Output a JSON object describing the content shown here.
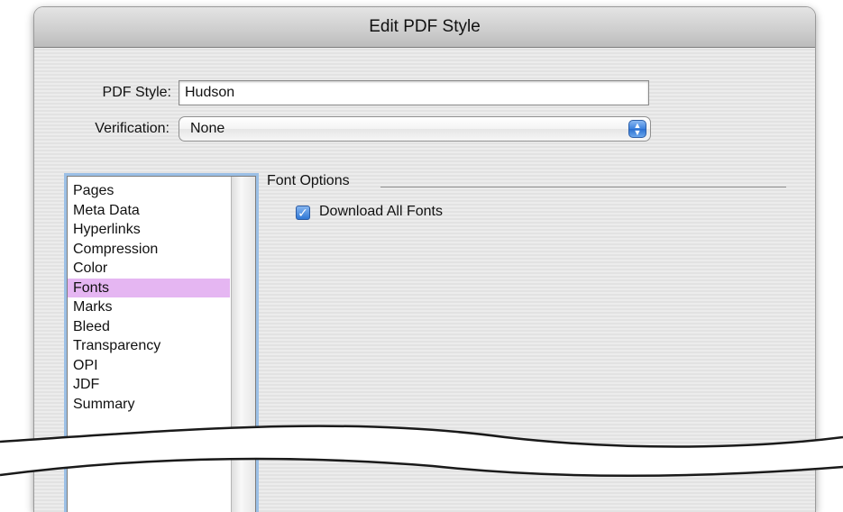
{
  "window": {
    "title": "Edit PDF Style"
  },
  "form": {
    "pdf_style_label": "PDF Style:",
    "pdf_style_value": "Hudson",
    "verification_label": "Verification:",
    "verification_value": "None"
  },
  "sidebar": {
    "items": [
      {
        "label": "Pages"
      },
      {
        "label": "Meta Data"
      },
      {
        "label": "Hyperlinks"
      },
      {
        "label": "Compression"
      },
      {
        "label": "Color"
      },
      {
        "label": "Fonts",
        "selected": true
      },
      {
        "label": "Marks"
      },
      {
        "label": "Bleed"
      },
      {
        "label": "Transparency"
      },
      {
        "label": "OPI"
      },
      {
        "label": "JDF"
      },
      {
        "label": "Summary"
      }
    ]
  },
  "panel": {
    "section_title": "Font Options",
    "download_all_fonts_label": "Download All Fonts",
    "download_all_fonts_checked": true
  },
  "colors": {
    "selection": "#e5b6f2",
    "accent": "#2f77d6",
    "focus_ring": "#9cc0e6"
  }
}
